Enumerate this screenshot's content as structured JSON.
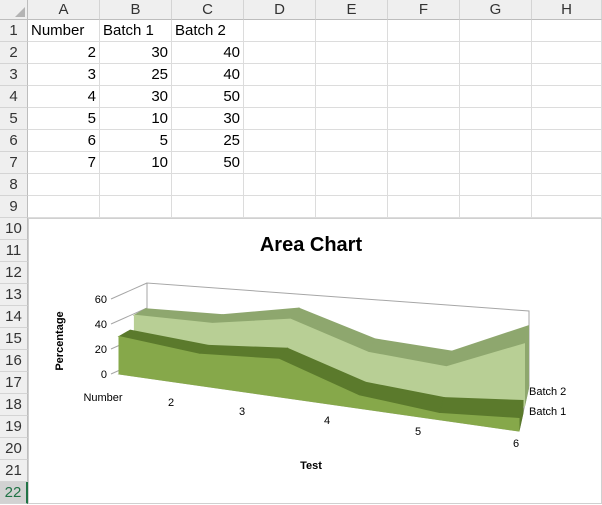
{
  "spreadsheet": {
    "columns": [
      "A",
      "B",
      "C",
      "D",
      "E",
      "F",
      "G",
      "H"
    ],
    "rows": [
      "1",
      "2",
      "3",
      "4",
      "5",
      "6",
      "7",
      "8",
      "9",
      "10",
      "11",
      "12",
      "13",
      "14",
      "15",
      "16",
      "17",
      "18",
      "19",
      "20",
      "21",
      "22"
    ],
    "selected_row": "22",
    "cells": {
      "header": [
        "Number",
        "Batch 1",
        "Batch 2"
      ],
      "data": [
        [
          "2",
          "30",
          "40"
        ],
        [
          "3",
          "25",
          "40"
        ],
        [
          "4",
          "30",
          "50"
        ],
        [
          "5",
          "10",
          "30"
        ],
        [
          "6",
          "5",
          "25"
        ],
        [
          "7",
          "10",
          "50"
        ]
      ]
    }
  },
  "chart_data": {
    "type": "area",
    "title": "Area Chart",
    "xlabel": "Test",
    "ylabel": "Percentage",
    "categories": [
      "Number",
      "2",
      "3",
      "4",
      "5",
      "6"
    ],
    "yticks": [
      "0",
      "20",
      "40",
      "60"
    ],
    "ylim": [
      0,
      60
    ],
    "series": [
      {
        "name": "Batch 1",
        "values": [
          30,
          25,
          30,
          10,
          5,
          10
        ],
        "color": "#86a84a"
      },
      {
        "name": "Batch 2",
        "values": [
          40,
          40,
          50,
          30,
          25,
          50
        ],
        "color": "#b8cf95"
      }
    ],
    "legend": "right",
    "style": "3-D area"
  }
}
